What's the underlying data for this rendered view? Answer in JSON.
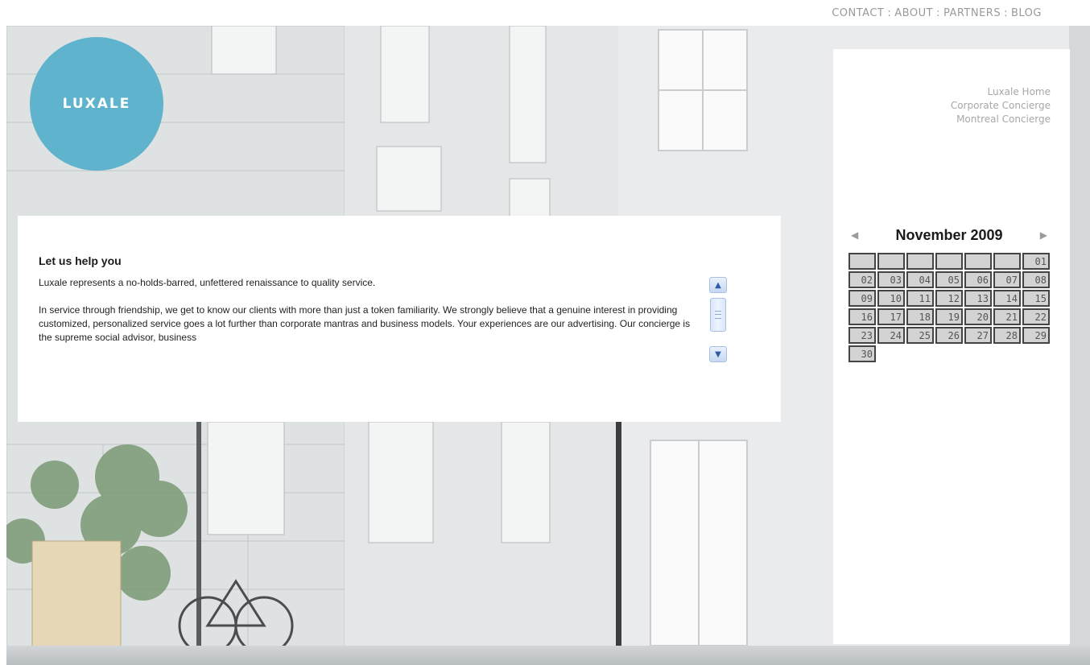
{
  "nav": {
    "links": [
      "CONTACT",
      "ABOUT",
      "PARTNERS",
      "BLOG"
    ],
    "separator": ":"
  },
  "logo": {
    "text": "LUXALE",
    "color": "#5fb3cc"
  },
  "content": {
    "heading": "Let us help you",
    "paragraphs": [
      "Luxale represents a no-holds-barred, unfettered renaissance to quality service.",
      "In service through friendship, we get to know our clients with more than just a token familiarity. We strongly believe that a genuine interest in providing customized, personalized service goes a lot further than corporate mantras and business models. Your experiences are our advertising. Our concierge is the supreme social advisor, business"
    ]
  },
  "sidebar": {
    "links": [
      "Luxale Home",
      "Corporate Concierge",
      "Montreal Concierge"
    ]
  },
  "calendar": {
    "month_label": "November 2009",
    "prev_icon": "triangle-left-icon",
    "next_icon": "triangle-right-icon",
    "leading_blanks": 6,
    "days": [
      "01",
      "02",
      "03",
      "04",
      "05",
      "06",
      "07",
      "08",
      "09",
      "10",
      "11",
      "12",
      "13",
      "14",
      "15",
      "16",
      "17",
      "18",
      "19",
      "20",
      "21",
      "22",
      "23",
      "24",
      "25",
      "26",
      "27",
      "28",
      "29",
      "30"
    ]
  }
}
